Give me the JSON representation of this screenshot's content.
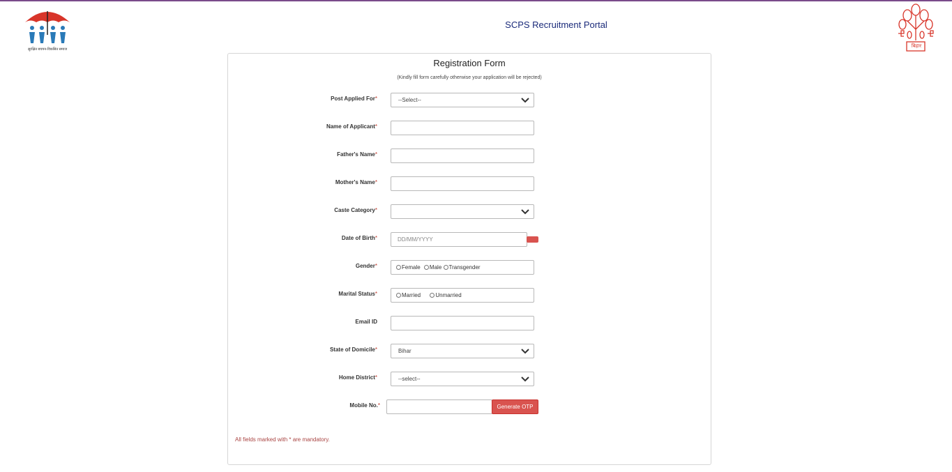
{
  "header": {
    "portal_title": "SCPS Recruitment Portal",
    "logo_left_caption": "सुरक्षित बचपन-विकसित समाज",
    "logo_right_text": "बिहार"
  },
  "form": {
    "title": "Registration Form",
    "note": "(Kindly fill form carefully otherwise your application will be rejected)",
    "fields": {
      "post": {
        "label": "Post Applied For",
        "required": "*",
        "value": "--Select--"
      },
      "name": {
        "label": "Name of Applicant",
        "required": "*",
        "value": ""
      },
      "father": {
        "label": "Father's Name",
        "required": "*",
        "value": ""
      },
      "mother": {
        "label": "Mother's Name",
        "required": "*",
        "value": ""
      },
      "caste": {
        "label": "Caste Category",
        "required": "*",
        "value": ""
      },
      "dob": {
        "label": "Date of Birth",
        "required": "*",
        "placeholder": "DD/MM/YYYY"
      },
      "gender": {
        "label": "Gender",
        "required": "*",
        "options": [
          "Female",
          "Male",
          "Transgender"
        ]
      },
      "marital": {
        "label": "Marital Status",
        "required": "*",
        "options": [
          "Married",
          "Unmarried"
        ]
      },
      "email": {
        "label": "Email ID",
        "value": ""
      },
      "domicile": {
        "label": "State of Domicile",
        "required": "*",
        "value": "Bihar"
      },
      "district": {
        "label": "Home District",
        "required": "*",
        "value": "--select--"
      },
      "mobile": {
        "label": "Mobile No.",
        "required": "*",
        "value": "",
        "button": "Generate OTP"
      }
    },
    "mandatory_note": "All fields marked with * are mandatory."
  },
  "colors": {
    "accent_red": "#d9534f",
    "title_blue": "#1a2a7a"
  }
}
